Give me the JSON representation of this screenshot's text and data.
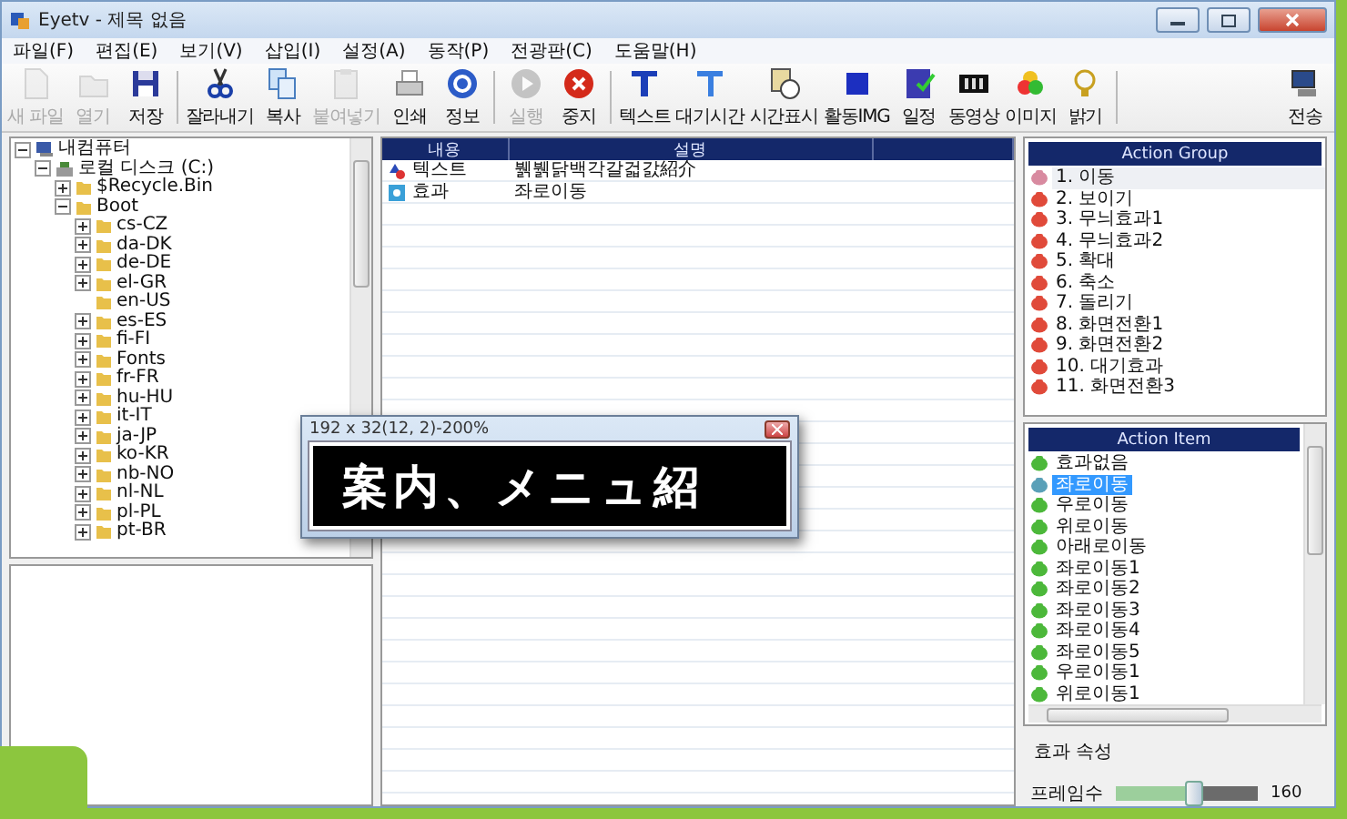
{
  "window": {
    "title": "Eyetv - 제목 없음"
  },
  "menu": [
    "파일(F)",
    "편집(E)",
    "보기(V)",
    "삽입(I)",
    "설정(A)",
    "동작(P)",
    "전광판(C)",
    "도움말(H)"
  ],
  "toolbar": {
    "groups": [
      {
        "buttons": [
          {
            "label": "새 파일",
            "disabled": true
          },
          {
            "label": "열기",
            "disabled": true
          },
          {
            "label": "저장",
            "disabled": false
          }
        ]
      },
      {
        "buttons": [
          {
            "label": "잘라내기",
            "disabled": false
          },
          {
            "label": "복사",
            "disabled": false
          },
          {
            "label": "붙여넣기",
            "disabled": true
          },
          {
            "label": "인쇄",
            "disabled": false
          },
          {
            "label": "정보",
            "disabled": false
          }
        ]
      },
      {
        "buttons": [
          {
            "label": "실행",
            "disabled": true
          },
          {
            "label": "중지",
            "disabled": false
          }
        ]
      },
      {
        "buttons": [
          {
            "label": "텍스트",
            "disabled": false
          },
          {
            "label": "대기시간",
            "disabled": false
          },
          {
            "label": "시간표시",
            "disabled": false
          },
          {
            "label": "활동IMG",
            "disabled": false
          },
          {
            "label": "일정",
            "disabled": false
          },
          {
            "label": "동영상",
            "disabled": false
          },
          {
            "label": "이미지",
            "disabled": false
          },
          {
            "label": "밝기",
            "disabled": false
          }
        ]
      },
      {
        "buttons": [
          {
            "label": "전송",
            "disabled": false
          }
        ]
      }
    ]
  },
  "tree": [
    {
      "label": "내컴퓨터",
      "expanded": true,
      "kind": "computer",
      "children": [
        {
          "label": "로컬 디스크 (C:)",
          "expanded": true,
          "kind": "drive",
          "children": [
            {
              "label": "$Recycle.Bin",
              "expanded": false,
              "kind": "folder"
            },
            {
              "label": "Boot",
              "expanded": true,
              "kind": "folder",
              "children": [
                {
                  "label": "cs-CZ",
                  "expanded": false,
                  "kind": "folder"
                },
                {
                  "label": "da-DK",
                  "expanded": false,
                  "kind": "folder"
                },
                {
                  "label": "de-DE",
                  "expanded": false,
                  "kind": "folder"
                },
                {
                  "label": "el-GR",
                  "expanded": false,
                  "kind": "folder"
                },
                {
                  "label": "en-US",
                  "kind": "empty-folder"
                },
                {
                  "label": "es-ES",
                  "expanded": false,
                  "kind": "folder"
                },
                {
                  "label": "fi-FI",
                  "expanded": false,
                  "kind": "folder"
                },
                {
                  "label": "Fonts",
                  "expanded": false,
                  "kind": "folder"
                },
                {
                  "label": "fr-FR",
                  "expanded": false,
                  "kind": "folder"
                },
                {
                  "label": "hu-HU",
                  "expanded": false,
                  "kind": "folder"
                },
                {
                  "label": "it-IT",
                  "expanded": false,
                  "kind": "folder"
                },
                {
                  "label": "ja-JP",
                  "expanded": false,
                  "kind": "folder"
                },
                {
                  "label": "ko-KR",
                  "expanded": false,
                  "kind": "folder"
                },
                {
                  "label": "nb-NO",
                  "expanded": false,
                  "kind": "folder"
                },
                {
                  "label": "nl-NL",
                  "expanded": false,
                  "kind": "folder"
                },
                {
                  "label": "pl-PL",
                  "expanded": false,
                  "kind": "folder"
                },
                {
                  "label": "pt-BR",
                  "expanded": false,
                  "kind": "folder"
                }
              ]
            }
          ]
        }
      ]
    }
  ],
  "table": {
    "columns": [
      "내용",
      "설명"
    ],
    "rows": [
      {
        "kind": "text",
        "cells": [
          "텍스트",
          "뷁뷁닭백각갈걻갌紹介"
        ]
      },
      {
        "kind": "effect",
        "cells": [
          "효과",
          "좌로이동"
        ]
      }
    ]
  },
  "zoom_window": {
    "title": "192 x 32(12, 2)-200%",
    "preview_text": "案内、メニュ紹"
  },
  "action_group": {
    "title": "Action Group",
    "items": [
      {
        "label": "1. 이동",
        "selected": true
      },
      {
        "label": "2. 보이기",
        "selected": false
      },
      {
        "label": "3. 무늬효과1",
        "selected": false
      },
      {
        "label": "4. 무늬효과2",
        "selected": false
      },
      {
        "label": "5. 확대",
        "selected": false
      },
      {
        "label": "6. 축소",
        "selected": false
      },
      {
        "label": "7. 돌리기",
        "selected": false
      },
      {
        "label": "8. 화면전환1",
        "selected": false
      },
      {
        "label": "9. 화면전환2",
        "selected": false
      },
      {
        "label": "10. 대기효과",
        "selected": false
      },
      {
        "label": "11. 화면전환3",
        "selected": false
      }
    ]
  },
  "action_item": {
    "title": "Action Item",
    "items": [
      {
        "label": "효과없음",
        "selected": false
      },
      {
        "label": "좌로이동",
        "selected": true
      },
      {
        "label": "우로이동",
        "selected": false
      },
      {
        "label": "위로이동",
        "selected": false
      },
      {
        "label": "아래로이동",
        "selected": false
      },
      {
        "label": "좌로이동1",
        "selected": false
      },
      {
        "label": "좌로이동2",
        "selected": false
      },
      {
        "label": "좌로이동3",
        "selected": false
      },
      {
        "label": "좌로이동4",
        "selected": false
      },
      {
        "label": "좌로이동5",
        "selected": false
      },
      {
        "label": "우로이동1",
        "selected": false
      },
      {
        "label": "위로이동1",
        "selected": false
      }
    ]
  },
  "properties": {
    "title": "효과 속성",
    "frames": {
      "label": "프레임수",
      "level": 0.55,
      "reading": "160"
    }
  }
}
